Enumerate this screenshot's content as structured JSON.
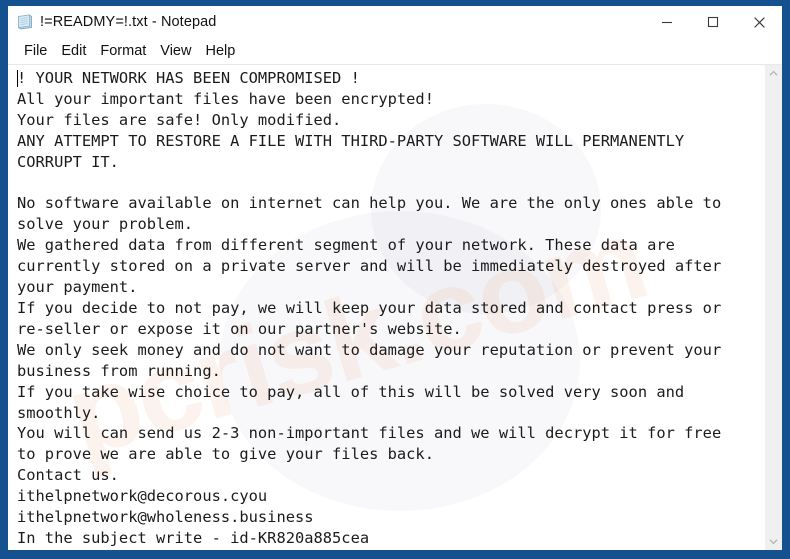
{
  "window": {
    "title": "!=READMY=!.txt - Notepad",
    "icon": "notepad-document-icon",
    "frame_color": "#15518f",
    "background_color": "#ffffff"
  },
  "window_controls": {
    "minimize": "minimize-icon",
    "maximize": "maximize-icon",
    "close": "close-icon"
  },
  "menu": {
    "items": [
      {
        "label": "File"
      },
      {
        "label": "Edit"
      },
      {
        "label": "Format"
      },
      {
        "label": "View"
      },
      {
        "label": "Help"
      }
    ]
  },
  "document": {
    "body": "! YOUR NETWORK HAS BEEN COMPROMISED !\nAll your important files have been encrypted!\nYour files are safe! Only modified.\nANY ATTEMPT TO RESTORE A FILE WITH THIRD-PARTY SOFTWARE WILL PERMANENTLY\nCORRUPT IT.\n\nNo software available on internet can help you. We are the only ones able to\nsolve your problem.\nWe gathered data from different segment of your network. These data are\ncurrently stored on a private server and will be immediately destroyed after\nyour payment.\nIf you decide to not pay, we will keep your data stored and contact press or\nre-seller or expose it on our partner's website.\nWe only seek money and do not want to damage your reputation or prevent your\nbusiness from running.\nIf you take wise choice to pay, all of this will be solved very soon and\nsmoothly.\nYou will can send us 2-3 non-important files and we will decrypt it for free\nto prove we are able to give your files back.\nContact us.\nithelpnetwork@decorous.cyou\nithelpnetwork@wholeness.business\nIn the subject write - id-KR820a885cea",
    "contact_emails": [
      "ithelpnetwork@decorous.cyou",
      "ithelpnetwork@wholeness.business"
    ],
    "victim_id": "id-KR820a885cea",
    "text_color": "#1b1b1b"
  },
  "watermark": {
    "text": "pcrisk.com"
  },
  "scrollbar": {
    "up_arrow": "chevron-up-icon",
    "down_arrow": "chevron-down-icon"
  }
}
